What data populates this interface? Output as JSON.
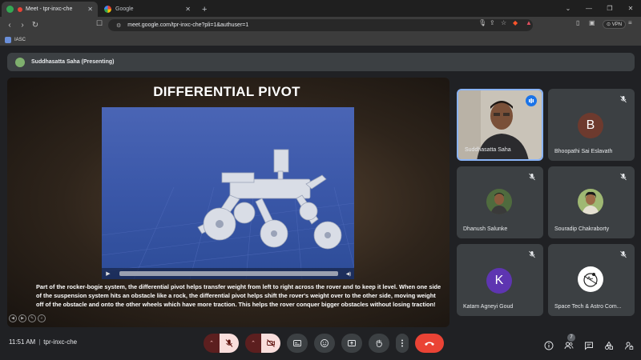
{
  "browser": {
    "tabs": [
      {
        "title": "Meet - tpr-inxc-che",
        "active": true
      },
      {
        "title": "Google",
        "active": false
      }
    ],
    "url": "meet.google.com/tpr-inxc-che?pli=1&authuser=1",
    "vpn_label": "VPN",
    "bookmark": "IASC"
  },
  "meet": {
    "presenter_label": "Suddhasatta Saha (Presenting)",
    "slide": {
      "title": "DIFFERENTIAL PIVOT",
      "caption": "Part of the rocker-bogie system, the differential pivot helps transfer weight from left to right across the rover and to keep it level. When one side of the suspension system hits an obstacle like a rock, the differential pivot helps shift the rover's weight over to the other side, moving weight off of the obstacle and onto the other wheels which have more traction. This helps the rover conquer bigger obstacles without losing traction!"
    },
    "participants": [
      {
        "name": "Suddhasatta Saha",
        "type": "video",
        "speaking": true
      },
      {
        "name": "Bhoopathi Sai Eslavath",
        "type": "letter",
        "letter": "B",
        "color": "#6d3a2e",
        "muted": true
      },
      {
        "name": "Dhanush Salunke",
        "type": "photo",
        "muted": true
      },
      {
        "name": "Souradip Chakraborty",
        "type": "photo",
        "muted": true
      },
      {
        "name": "Katam Agneyi Goud",
        "type": "letter",
        "letter": "K",
        "color": "#5e35b1",
        "muted": true
      },
      {
        "name": "Space Tech & Astro Com...",
        "type": "logo",
        "muted": true
      }
    ],
    "bottom": {
      "time": "11:51 AM",
      "meeting_code": "tpr-inxc-che",
      "people_count": "7"
    }
  },
  "colors": {
    "end_call": "#ea4335",
    "muted_bg": "#f9dedc",
    "speaking": "#1a73e8"
  }
}
